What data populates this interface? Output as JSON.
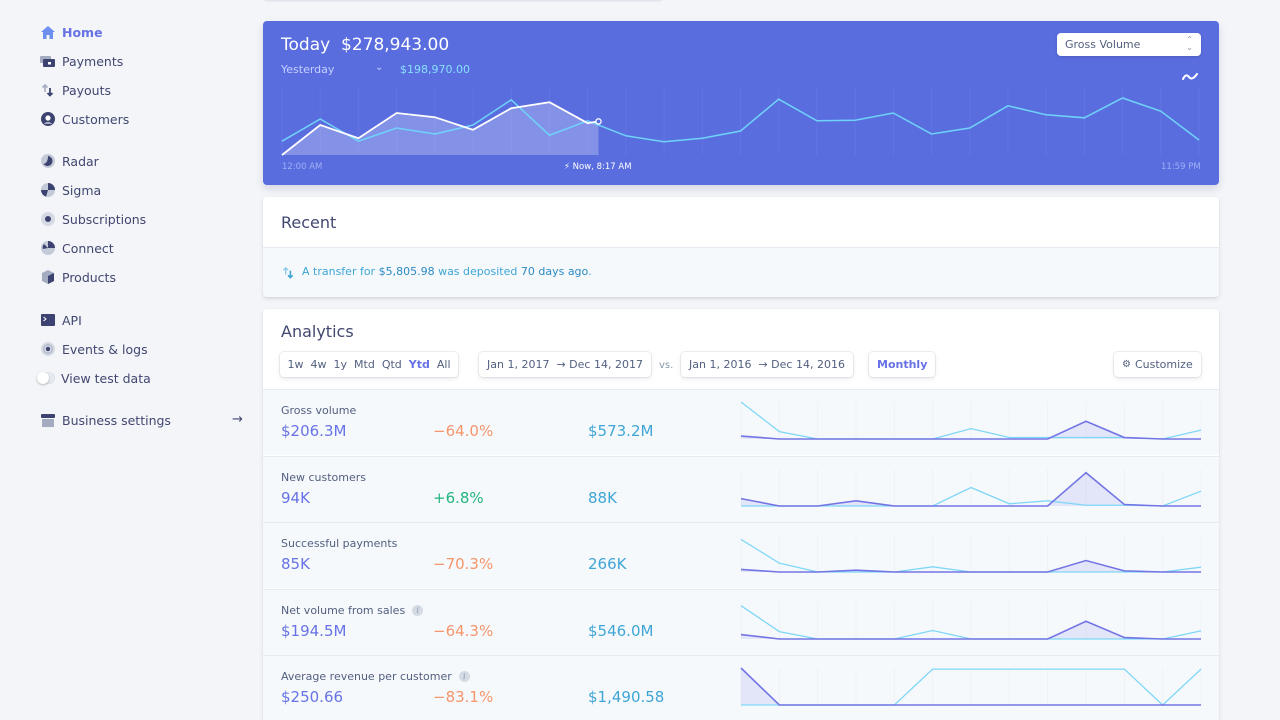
{
  "sidebar": {
    "items": [
      {
        "label": "Home",
        "icon": "home-icon",
        "active": true
      },
      {
        "label": "Payments",
        "icon": "payments-icon"
      },
      {
        "label": "Payouts",
        "icon": "payouts-icon"
      },
      {
        "label": "Customers",
        "icon": "customers-icon"
      },
      {
        "label": "Radar",
        "icon": "radar-icon"
      },
      {
        "label": "Sigma",
        "icon": "sigma-icon"
      },
      {
        "label": "Subscriptions",
        "icon": "subscriptions-icon"
      },
      {
        "label": "Connect",
        "icon": "connect-icon"
      },
      {
        "label": "Products",
        "icon": "products-icon"
      },
      {
        "label": "API",
        "icon": "api-icon"
      },
      {
        "label": "Events & logs",
        "icon": "events-icon"
      },
      {
        "label": "View test data",
        "icon": "toggle"
      },
      {
        "label": "Business settings",
        "icon": "business-settings-icon"
      }
    ],
    "business_arrow": "→"
  },
  "hero": {
    "today_label": "Today",
    "today_amount": "$278,943.00",
    "compare_label": "Yesterday",
    "compare_chevron": "⌄",
    "compare_amount": "$198,970.00",
    "metric_select": "Gross Volume",
    "start_label": "12:00 AM",
    "now_label": "⚡ Now, 8:17 AM",
    "end_label": "11:59 PM",
    "colors": {
      "background": "#5a6ddf",
      "today_line": "#ffffff",
      "yesterday_line": "#6fd3fa"
    }
  },
  "chart_data": {
    "type": "line",
    "title": "Gross Volume",
    "x_labels": [
      "12:00 AM",
      "Now, 8:17 AM",
      "11:59 PM"
    ],
    "x_hours": [
      0,
      1,
      2,
      3,
      4,
      5,
      6,
      7,
      8,
      9,
      10,
      11,
      12,
      13,
      14,
      15,
      16,
      17,
      18,
      19,
      20,
      21,
      22,
      23,
      24
    ],
    "series": [
      {
        "name": "Yesterday",
        "values": [
          23,
          60,
          23,
          45,
          35,
          50,
          92,
          33,
          57,
          32,
          22,
          28,
          40,
          93,
          57,
          58,
          70,
          35,
          45,
          82,
          67,
          62,
          95,
          73,
          25
        ]
      },
      {
        "name": "Today",
        "values": [
          0,
          50,
          28,
          70,
          63,
          42,
          78,
          88,
          53
        ],
        "now_value": 56
      }
    ],
    "ylim": [
      0,
      100
    ],
    "grid": "vertical"
  },
  "recent": {
    "title": "Recent",
    "message_prefix": "A transfer for ",
    "amount": "$5,805.98",
    "message_mid": " was deposited ",
    "age": "70 days ago",
    "message_suffix": "."
  },
  "analytics": {
    "title": "Analytics",
    "ranges": [
      {
        "label": "1w"
      },
      {
        "label": "4w"
      },
      {
        "label": "1y"
      },
      {
        "label": "Mtd"
      },
      {
        "label": "Qtd"
      },
      {
        "label": "Ytd",
        "selected": true
      },
      {
        "label": "All"
      }
    ],
    "current_range": {
      "start": "Jan 1, 2017",
      "arrow": "→",
      "end": "Dec 14, 2017"
    },
    "vs_label": "vs.",
    "previous_range": {
      "start": "Jan 1, 2016",
      "arrow": "→",
      "end": "Dec 14, 2016"
    },
    "interval": "Monthly",
    "customize_label": "Customize",
    "metrics": [
      {
        "label": "Gross volume",
        "info": false,
        "value": "$206.3M",
        "change": "−64.0%",
        "trend": "neg",
        "previous": "$573.2M",
        "current_series": [
          8,
          0,
          0,
          0,
          0,
          0,
          0,
          0,
          0,
          48,
          4,
          0,
          0
        ],
        "previous_series": [
          100,
          20,
          0,
          0,
          0,
          0,
          28,
          4,
          4,
          4,
          4,
          0,
          24
        ]
      },
      {
        "label": "New customers",
        "info": false,
        "value": "94K",
        "change": "+6.8%",
        "trend": "pos",
        "previous": "88K",
        "current_series": [
          20,
          0,
          0,
          14,
          0,
          0,
          0,
          0,
          0,
          90,
          4,
          0,
          0
        ],
        "previous_series": [
          0,
          0,
          0,
          0,
          0,
          0,
          50,
          6,
          14,
          2,
          2,
          0,
          40
        ]
      },
      {
        "label": "Successful payments",
        "info": false,
        "value": "85K",
        "change": "−70.3%",
        "trend": "neg",
        "previous": "266K",
        "current_series": [
          7,
          0,
          0,
          5,
          0,
          0,
          0,
          0,
          0,
          31,
          3,
          0,
          0
        ],
        "previous_series": [
          88,
          24,
          0,
          0,
          0,
          14,
          0,
          0,
          0,
          0,
          0,
          0,
          13
        ]
      },
      {
        "label": "Net volume from sales",
        "info": true,
        "value": "$194.5M",
        "change": "−64.3%",
        "trend": "neg",
        "previous": "$546.0M",
        "current_series": [
          12,
          0,
          0,
          0,
          0,
          0,
          0,
          0,
          0,
          48,
          4,
          0,
          0
        ],
        "previous_series": [
          90,
          20,
          0,
          0,
          0,
          23,
          0,
          0,
          0,
          0,
          0,
          0,
          22
        ]
      },
      {
        "label": "Average revenue per customer",
        "info": true,
        "value": "$250.66",
        "change": "−83.1%",
        "trend": "neg",
        "previous": "$1,490.58",
        "current_series": [
          100,
          0,
          0,
          0,
          0,
          0,
          0,
          0,
          0,
          0,
          0,
          0,
          0
        ],
        "previous_series": [
          0,
          0,
          0,
          0,
          0,
          97,
          97,
          97,
          97,
          97,
          97,
          0,
          97
        ]
      }
    ],
    "colors": {
      "current": "#7375e4",
      "previous": "#7fd7f7",
      "negative": "#f5956c",
      "positive": "#24b47e"
    }
  }
}
